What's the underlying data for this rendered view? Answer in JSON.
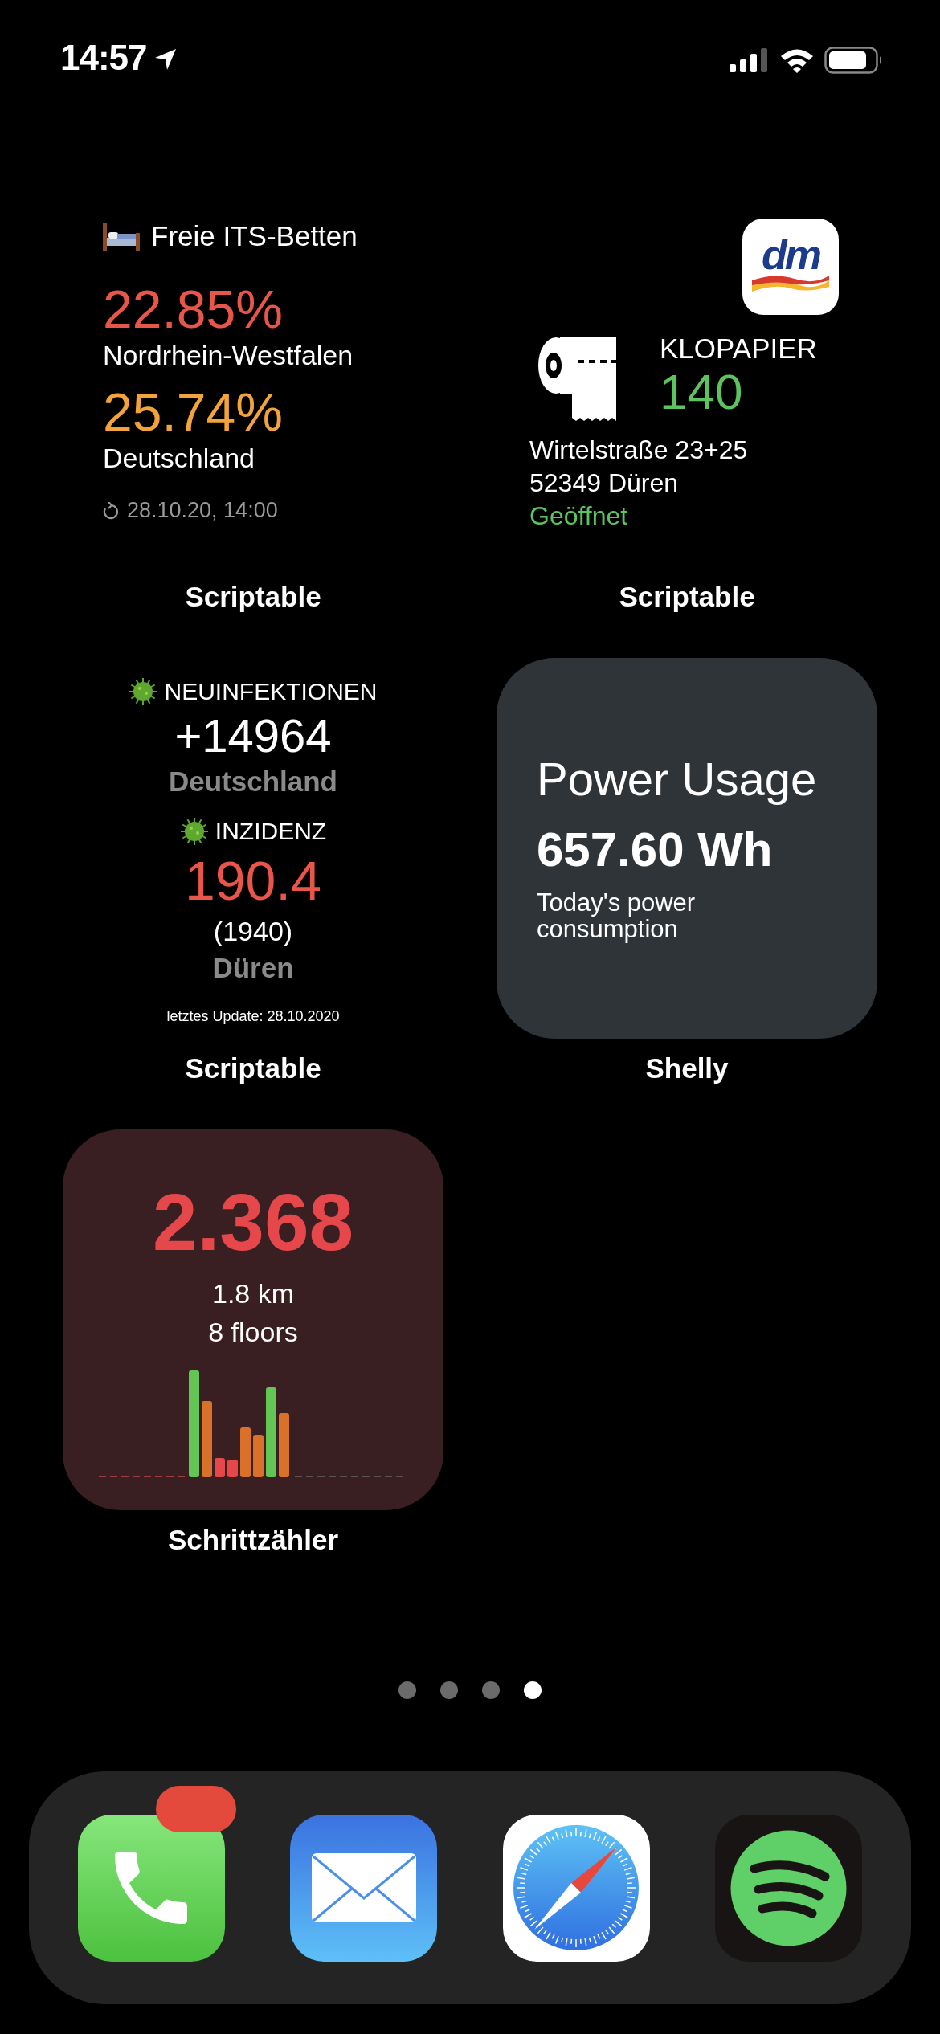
{
  "status_bar": {
    "time": "14:57"
  },
  "widgets": [
    {
      "kind": "beds",
      "app": "Scriptable",
      "title": "Freie ITS-Betten",
      "stats": [
        {
          "value": "22.85%",
          "color": "#e8564a",
          "region": "Nordrhein-Westfalen"
        },
        {
          "value": "25.74%",
          "color": "#f2a33a",
          "region": "Deutschland"
        }
      ],
      "updated": "28.10.20, 14:00"
    },
    {
      "kind": "stock",
      "app": "Scriptable",
      "logo": "dm",
      "product": "KLOPAPIER",
      "count": "140",
      "address": [
        "Wirtelstraße 23+25",
        "52349 Düren"
      ],
      "status": "Geöffnet"
    },
    {
      "kind": "covid",
      "app": "Scriptable",
      "sections": [
        {
          "heading": "NEUINFEKTIONEN",
          "value": "+14964",
          "color": "#ffffff",
          "place": "Deutschland"
        },
        {
          "heading": "INZIDENZ",
          "value": "190.4",
          "color": "#e8564a",
          "sub": "(1940)",
          "place": "Düren"
        }
      ],
      "updated": "letztes Update: 28.10.2020"
    },
    {
      "kind": "power",
      "app": "Shelly",
      "title": "Power Usage",
      "value": "657.60 Wh",
      "caption": "Today's power consumption"
    },
    {
      "kind": "steps",
      "app": "Schrittzähler",
      "steps": "2.368",
      "distance": "1.8 km",
      "floors": "8 floors"
    }
  ],
  "page_dots": [
    {
      "selected": false
    },
    {
      "selected": false
    },
    {
      "selected": false
    },
    {
      "selected": true
    }
  ],
  "dock": [
    {
      "kind": "phone",
      "badge": true
    },
    {
      "kind": "mail"
    },
    {
      "kind": "safari"
    },
    {
      "kind": "spotify"
    }
  ]
}
